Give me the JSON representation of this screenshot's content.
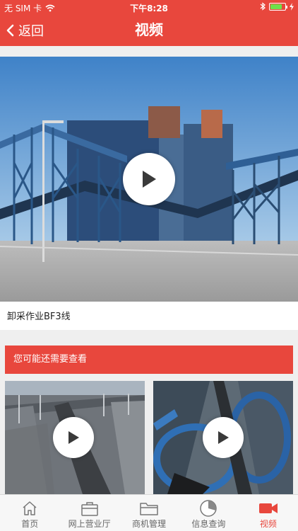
{
  "status_bar": {
    "carrier": "无 SIM 卡",
    "time": "下午8:28",
    "icons": [
      "wifi-icon",
      "bluetooth-icon",
      "battery-icon",
      "charging-icon"
    ],
    "battery_level": 0.8
  },
  "nav": {
    "back_label": "返回",
    "title": "视频"
  },
  "main_video": {
    "caption": "卸采作业BF3线"
  },
  "recommend": {
    "header": "您可能还需要查看"
  },
  "tabs": [
    {
      "label": "首页",
      "icon": "home-icon",
      "active": false
    },
    {
      "label": "网上营业厅",
      "icon": "briefcase-icon",
      "active": false
    },
    {
      "label": "商机管理",
      "icon": "folder-icon",
      "active": false
    },
    {
      "label": "信息查询",
      "icon": "pie-chart-icon",
      "active": false
    },
    {
      "label": "视频",
      "icon": "video-camera-icon",
      "active": true
    }
  ],
  "colors": {
    "accent": "#e8473d",
    "background": "#efefef",
    "tab_inactive": "#666666"
  }
}
